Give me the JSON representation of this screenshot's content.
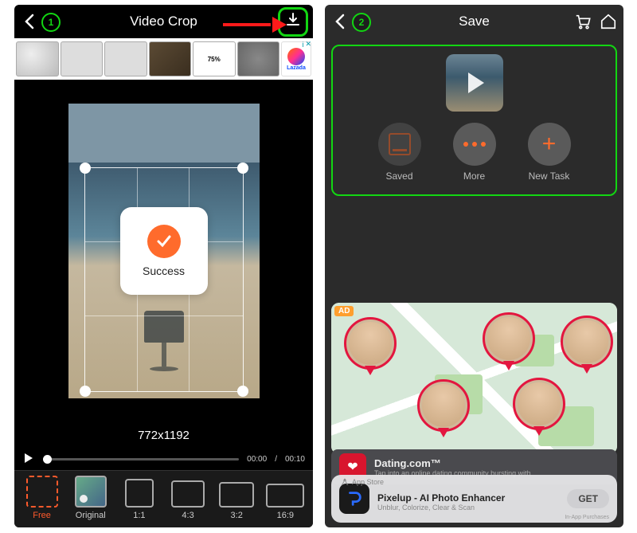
{
  "left": {
    "title": "Video Crop",
    "step": "1",
    "ad_brand": "Lazada",
    "ad_info": "i",
    "success": "Success",
    "dimensions": "772x1192",
    "time_current": "00:00",
    "time_total": "00:10",
    "ratios": {
      "free": "Free",
      "original": "Original",
      "r11": "1:1",
      "r43": "4:3",
      "r32": "3:2",
      "r169": "16:9"
    }
  },
  "right": {
    "title": "Save",
    "step": "2",
    "actions": {
      "saved": "Saved",
      "more": "More",
      "new": "New Task"
    },
    "ad_label": "AD",
    "dating": {
      "title": "Dating.com™",
      "sub": "Tap into an online dating community bursting with"
    },
    "sheet": {
      "store": "App Store",
      "title": "Pixelup - AI Photo Enhancer",
      "sub": "Unblur, Colorize, Clear & Scan",
      "get": "GET",
      "iap": "In-App Purchases"
    }
  }
}
